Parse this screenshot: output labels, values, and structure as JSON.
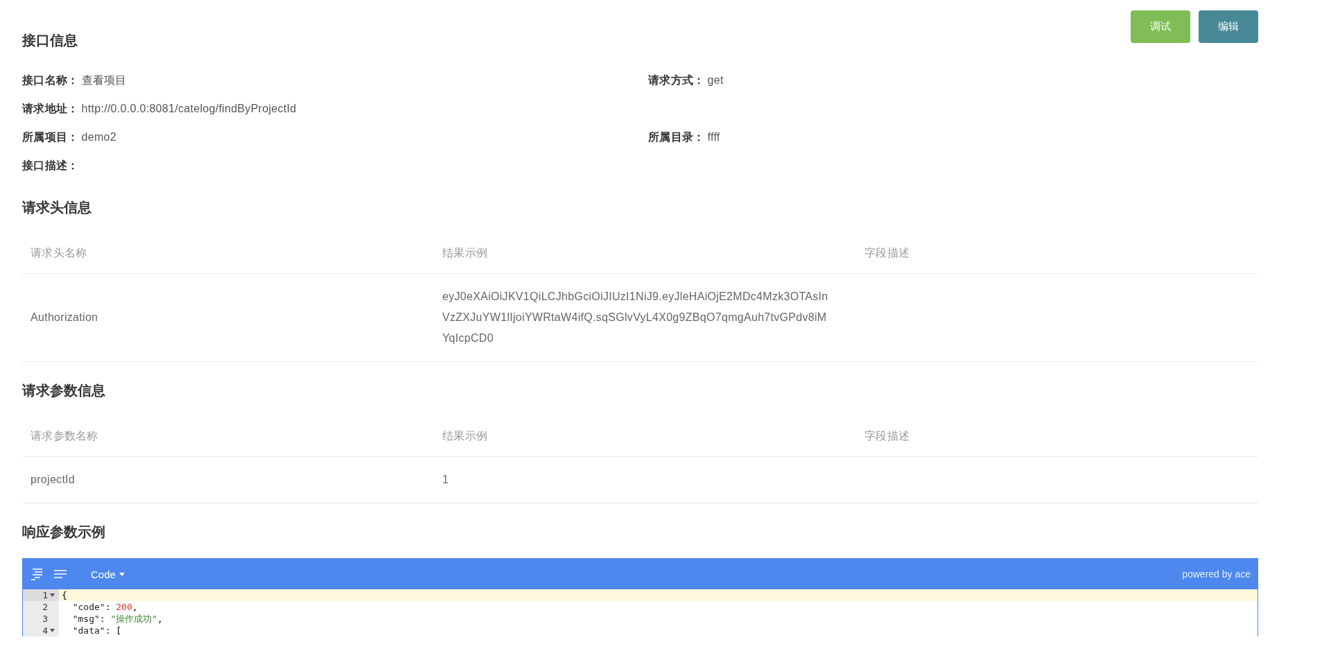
{
  "actions": [
    {
      "label": "调试",
      "kind": "debug"
    },
    {
      "label": "编辑",
      "kind": "edit"
    }
  ],
  "info": {
    "title": "接口信息",
    "rows": [
      {
        "left": {
          "label": "接口名称：",
          "value": "查看项目"
        },
        "right": {
          "label": "请求方式：",
          "value": "get"
        }
      },
      {
        "left": {
          "label": "请求地址：",
          "value": "http://0.0.0.0:8081/catelog/findByProjectId"
        }
      },
      {
        "left": {
          "label": "所属项目：",
          "value": "demo2"
        },
        "right": {
          "label": "所属目录：",
          "value": "ffff"
        }
      },
      {
        "left": {
          "label": "接口描述："
        }
      }
    ]
  },
  "tables": [
    {
      "title": "请求头信息",
      "columns": [
        "请求头名称",
        "结果示例",
        "字段描述"
      ],
      "rows": [
        [
          "Authorization",
          "eyJ0eXAiOiJKV1QiLCJhbGciOiJIUzI1NiJ9.eyJleHAiOjE2MDc4Mzk3OTAsInVzZXJuYW1lIjoiYWRtaW4ifQ.sqSGlvVyL4X0g9ZBqO7qmgAuh7tvGPdv8iMYqIcpCD0"
        ]
      ]
    },
    {
      "title": "请求参数信息",
      "columns": [
        "请求参数名称",
        "结果示例",
        "字段描述"
      ],
      "rows": [
        [
          "projectId",
          "1"
        ]
      ]
    }
  ],
  "response": {
    "title": "响应参数示例",
    "mode": "Code",
    "powered": "powered by ace",
    "lines": [
      {
        "number": "1",
        "foldable": true,
        "selected": true,
        "tokens": [
          {
            "text": "{",
            "kind": "punct"
          }
        ]
      },
      {
        "number": "2",
        "foldable": false,
        "selected": false,
        "tokens": [
          {
            "text": "  \"code\"",
            "kind": "key"
          },
          {
            "text": ": ",
            "kind": "punct"
          },
          {
            "text": "200",
            "kind": "number"
          },
          {
            "text": ",",
            "kind": "punct"
          }
        ]
      },
      {
        "number": "3",
        "foldable": false,
        "selected": false,
        "tokens": [
          {
            "text": "  \"msg\"",
            "kind": "key"
          },
          {
            "text": ": ",
            "kind": "punct"
          },
          {
            "text": "\"操作成功\"",
            "kind": "string"
          },
          {
            "text": ",",
            "kind": "punct"
          }
        ]
      },
      {
        "number": "4",
        "foldable": true,
        "selected": false,
        "tokens": [
          {
            "text": "  \"data\"",
            "kind": "key"
          },
          {
            "text": ": [",
            "kind": "punct"
          }
        ]
      }
    ]
  }
}
